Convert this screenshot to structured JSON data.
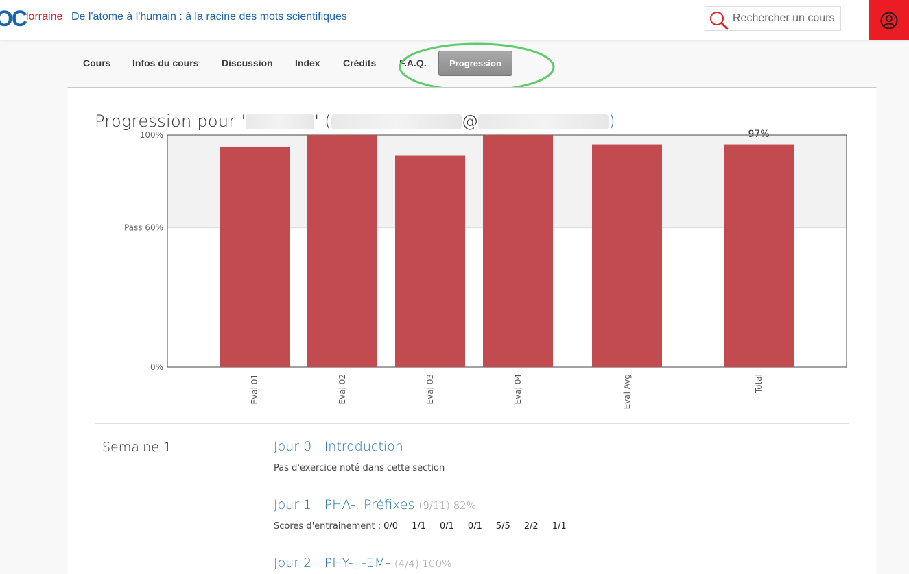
{
  "header": {
    "logo_text": "OC",
    "brand": "lorraine",
    "course_title": "De l'atome à l'humain : à la racine des mots scientifiques",
    "search_placeholder": "Rechercher un cours"
  },
  "nav": {
    "tabs": [
      {
        "label": "Cours"
      },
      {
        "label": "Infos du cours"
      },
      {
        "label": "Discussion"
      },
      {
        "label": "Index"
      },
      {
        "label": "Crédits"
      },
      {
        "label": "F.A.Q."
      }
    ],
    "active_label": "Progression"
  },
  "progress": {
    "title_prefix": "Progression pour '",
    "title_mid": "' (",
    "title_at": "@",
    "title_suffix": ")"
  },
  "chart_data": {
    "type": "bar",
    "categories": [
      "Eval 01",
      "Eval 02",
      "Eval 03",
      "Eval 04",
      "Eval Avg",
      "Total"
    ],
    "values": [
      95,
      100,
      91,
      100,
      96,
      96
    ],
    "ylim": [
      0,
      100
    ],
    "yticks": [
      "100%",
      "Pass 60%",
      "0%"
    ],
    "pass_value": 60,
    "total_label": "97%",
    "bar_color": "#c14b4e",
    "pass_band_color": "#f2f2f2"
  },
  "weeks": [
    {
      "label": "Semaine 1",
      "sections": [
        {
          "title": "Jour 0 : Introduction",
          "score": "",
          "note": "Pas d'exercice noté dans cette section"
        },
        {
          "title": "Jour 1 : PHA-, Préfixes",
          "score": "(9/11) 82%",
          "scores_label": "Scores d'entrainement :",
          "scores": [
            "0/0",
            "1/1",
            "0/1",
            "0/1",
            "5/5",
            "2/2",
            "1/1"
          ]
        },
        {
          "title": "Jour 2 : PHY-, -EM-",
          "score": "(4/4) 100%"
        }
      ]
    }
  ]
}
